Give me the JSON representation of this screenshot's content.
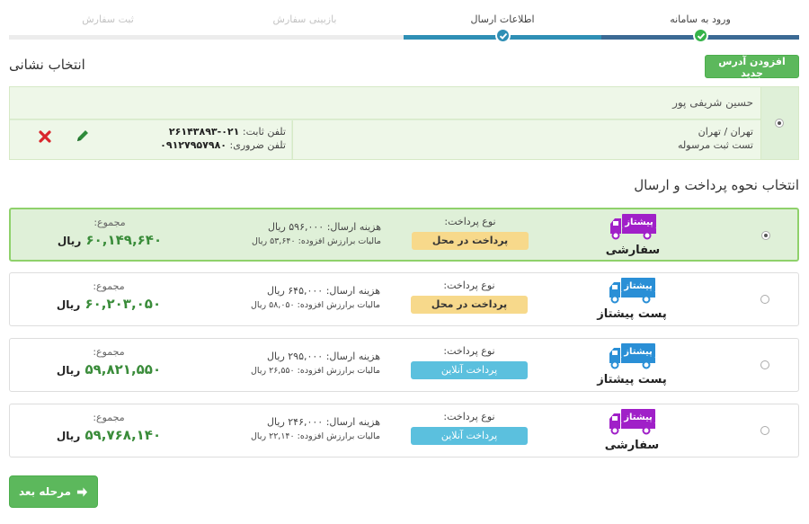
{
  "stepper": {
    "steps": [
      {
        "label": "ورود به سامانه",
        "state": "done"
      },
      {
        "label": "اطلاعات ارسال",
        "state": "active"
      },
      {
        "label": "بازبینی سفارش",
        "state": "todo"
      },
      {
        "label": "ثبت سفارش",
        "state": "todo"
      }
    ]
  },
  "address_section": {
    "title": "انتخاب نشانی",
    "add_button": "افزودن آدرس جدید",
    "address": {
      "name": "حسین شریفی پور",
      "city": "تهران / تهران",
      "note": "تست ثبت مرسوله",
      "landline_label": "تلفن ثابت:",
      "landline": "۰۲۱-۲۶۱۴۳۸۹۳",
      "mobile_label": "تلفن ضروری:",
      "mobile": "۰۹۱۲۷۹۵۷۹۸۰",
      "edit_icon": "pencil-icon",
      "delete_icon": "close-icon",
      "selected": true
    }
  },
  "shipping_section": {
    "title": "انتخاب نحوه پرداخت و ارسال",
    "options": [
      {
        "logo_text": "پیشتاز",
        "logo_color": "#a020c8",
        "caption": "سفارشی",
        "payment_label": "نوع پرداخت:",
        "payment": "پرداخت در محل",
        "payment_style": "warn",
        "shipping_cost": "هزینه ارسال: ۵۹۶,۰۰۰ ریال",
        "tax": "مالیات برارزش افزوده: ۵۳,۶۴۰ ریال",
        "total_label": "مجموع:",
        "total": "۶۰,۱۴۹,۶۴۰",
        "unit": "ریال",
        "selected": true
      },
      {
        "logo_text": "پیشتاز",
        "logo_color": "#2a8fd6",
        "caption": "پست پیشتاز",
        "payment_label": "نوع پرداخت:",
        "payment": "پرداخت در محل",
        "payment_style": "warn",
        "shipping_cost": "هزینه ارسال: ۶۴۵,۰۰۰ ریال",
        "tax": "مالیات برارزش افزوده: ۵۸,۰۵۰ ریال",
        "total_label": "مجموع:",
        "total": "۶۰,۲۰۳,۰۵۰",
        "unit": "ریال",
        "selected": false
      },
      {
        "logo_text": "پیشتاز",
        "logo_color": "#2a8fd6",
        "caption": "پست پیشتاز",
        "payment_label": "نوع پرداخت:",
        "payment": "پرداخت آنلاین",
        "payment_style": "info",
        "shipping_cost": "هزینه ارسال: ۲۹۵,۰۰۰ ریال",
        "tax": "مالیات برارزش افزوده: ۲۶,۵۵۰ ریال",
        "total_label": "مجموع:",
        "total": "۵۹,۸۲۱,۵۵۰",
        "unit": "ریال",
        "selected": false
      },
      {
        "logo_text": "پیشتاز",
        "logo_color": "#a020c8",
        "caption": "سفارشی",
        "payment_label": "نوع پرداخت:",
        "payment": "پرداخت آنلاین",
        "payment_style": "info",
        "shipping_cost": "هزینه ارسال: ۲۴۶,۰۰۰ ریال",
        "tax": "مالیات برارزش افزوده: ۲۲,۱۴۰ ریال",
        "total_label": "مجموع:",
        "total": "۵۹,۷۶۸,۱۴۰",
        "unit": "ریال",
        "selected": false
      }
    ]
  },
  "next_button": {
    "label": "مرحله بعد",
    "icon": "arrow-right-icon"
  },
  "colors": {
    "success": "#5cb85c",
    "step_done": "#3b6a94",
    "step_active": "#2f8fb5",
    "total_green": "#3a8c3a"
  }
}
